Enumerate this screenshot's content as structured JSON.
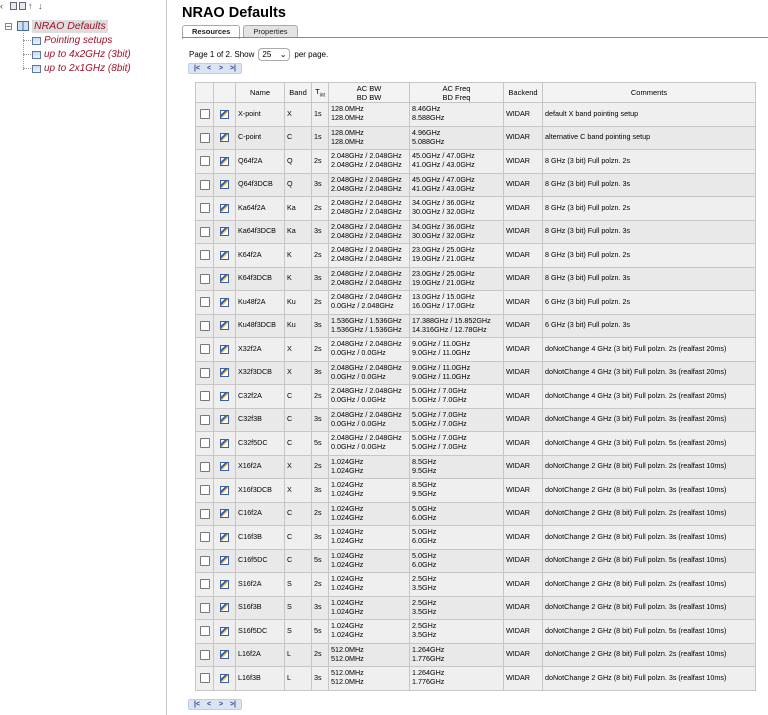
{
  "tree": {
    "root": {
      "label": "NRAO Defaults",
      "expander": "−"
    },
    "children": [
      {
        "label": "Pointing setups"
      },
      {
        "label": "up to 4x2GHz (3bit)"
      },
      {
        "label": "up to 2x1GHz (8bit)"
      }
    ]
  },
  "main": {
    "title": "NRAO Defaults",
    "tabs": [
      {
        "label": "Resources"
      },
      {
        "label": "Properties"
      }
    ],
    "pager": {
      "prefix": "Page 1 of 2. Show",
      "page_size": "25",
      "suffix": "per page."
    },
    "nav": {
      "first": "|<",
      "prev": "<",
      "next": ">",
      "last": ">|"
    }
  },
  "table": {
    "headers": {
      "name": "Name",
      "band": "Band",
      "tint": "T",
      "tint_sub": "int",
      "acbw": "AC BW",
      "bdbw": "BD BW",
      "acfreq": "AC Freq",
      "bdfreq": "BD Freq",
      "backend": "Backend",
      "comments": "Comments"
    },
    "rows": [
      {
        "name": "X-point",
        "band": "X",
        "tint": "1s",
        "bw1": "128.0MHz",
        "bw2": "128.0MHz",
        "f1": "8.46GHz",
        "f2": "8.588GHz",
        "backend": "WIDAR",
        "comment": "default X band pointing setup"
      },
      {
        "name": "C-point",
        "band": "C",
        "tint": "1s",
        "bw1": "128.0MHz",
        "bw2": "128.0MHz",
        "f1": "4.96GHz",
        "f2": "5.088GHz",
        "backend": "WIDAR",
        "comment": "alternative C band pointing setup"
      },
      {
        "name": "Q64f2A",
        "band": "Q",
        "tint": "2s",
        "bw1": "2.048GHz / 2.048GHz",
        "bw2": "2.048GHz / 2.048GHz",
        "f1": "45.0GHz / 47.0GHz",
        "f2": "41.0GHz / 43.0GHz",
        "backend": "WIDAR",
        "comment": "8 GHz (3 bit) Full polzn. 2s"
      },
      {
        "name": "Q64f3DCB",
        "band": "Q",
        "tint": "3s",
        "bw1": "2.048GHz / 2.048GHz",
        "bw2": "2.048GHz / 2.048GHz",
        "f1": "45.0GHz / 47.0GHz",
        "f2": "41.0GHz / 43.0GHz",
        "backend": "WIDAR",
        "comment": "8 GHz (3 bit) Full polzn. 3s"
      },
      {
        "name": "Ka64f2A",
        "band": "Ka",
        "tint": "2s",
        "bw1": "2.048GHz / 2.048GHz",
        "bw2": "2.048GHz / 2.048GHz",
        "f1": "34.0GHz / 36.0GHz",
        "f2": "30.0GHz / 32.0GHz",
        "backend": "WIDAR",
        "comment": "8 GHz (3 bit) Full polzn. 2s"
      },
      {
        "name": "Ka64f3DCB",
        "band": "Ka",
        "tint": "3s",
        "bw1": "2.048GHz / 2.048GHz",
        "bw2": "2.048GHz / 2.048GHz",
        "f1": "34.0GHz / 36.0GHz",
        "f2": "30.0GHz / 32.0GHz",
        "backend": "WIDAR",
        "comment": "8 GHz (3 bit) Full polzn. 3s"
      },
      {
        "name": "K64f2A",
        "band": "K",
        "tint": "2s",
        "bw1": "2.048GHz / 2.048GHz",
        "bw2": "2.048GHz / 2.048GHz",
        "f1": "23.0GHz / 25.0GHz",
        "f2": "19.0GHz / 21.0GHz",
        "backend": "WIDAR",
        "comment": "8 GHz (3 bit) Full polzn. 2s"
      },
      {
        "name": "K64f3DCB",
        "band": "K",
        "tint": "3s",
        "bw1": "2.048GHz / 2.048GHz",
        "bw2": "2.048GHz / 2.048GHz",
        "f1": "23.0GHz / 25.0GHz",
        "f2": "19.0GHz / 21.0GHz",
        "backend": "WIDAR",
        "comment": "8 GHz (3 bit) Full polzn. 3s"
      },
      {
        "name": "Ku48f2A",
        "band": "Ku",
        "tint": "2s",
        "bw1": "2.048GHz / 2.048GHz",
        "bw2": "0.0GHz / 2.048GHz",
        "f1": "13.0GHz / 15.0GHz",
        "f2": "16.0GHz / 17.0GHz",
        "backend": "WIDAR",
        "comment": "6 GHz (3 bit) Full polzn. 2s"
      },
      {
        "name": "Ku48f3DCB",
        "band": "Ku",
        "tint": "3s",
        "bw1": "1.536GHz / 1.536GHz",
        "bw2": "1.536GHz / 1.536GHz",
        "f1": "17.388GHz / 15.852GHz",
        "f2": "14.316GHz / 12.78GHz",
        "backend": "WIDAR",
        "comment": "6 GHz (3 bit) Full polzn. 3s"
      },
      {
        "name": "X32f2A",
        "band": "X",
        "tint": "2s",
        "bw1": "2.048GHz / 2.048GHz",
        "bw2": "0.0GHz / 0.0GHz",
        "f1": "9.0GHz / 11.0GHz",
        "f2": "9.0GHz / 11.0GHz",
        "backend": "WIDAR",
        "comment": "doNotChange 4 GHz (3 bit) Full polzn. 2s (realfast 20ms)"
      },
      {
        "name": "X32f3DCB",
        "band": "X",
        "tint": "3s",
        "bw1": "2.048GHz / 2.048GHz",
        "bw2": "0.0GHz / 0.0GHz",
        "f1": "9.0GHz / 11.0GHz",
        "f2": "9.0GHz / 11.0GHz",
        "backend": "WIDAR",
        "comment": "doNotChange 4 GHz (3 bit) Full polzn. 3s (realfast 20ms)"
      },
      {
        "name": "C32f2A",
        "band": "C",
        "tint": "2s",
        "bw1": "2.048GHz / 2.048GHz",
        "bw2": "0.0GHz / 0.0GHz",
        "f1": "5.0GHz / 7.0GHz",
        "f2": "5.0GHz / 7.0GHz",
        "backend": "WIDAR",
        "comment": "doNotChange 4 GHz (3 bit) Full polzn. 2s (realfast 20ms)"
      },
      {
        "name": "C32f3B",
        "band": "C",
        "tint": "3s",
        "bw1": "2.048GHz / 2.048GHz",
        "bw2": "0.0GHz / 0.0GHz",
        "f1": "5.0GHz / 7.0GHz",
        "f2": "5.0GHz / 7.0GHz",
        "backend": "WIDAR",
        "comment": "doNotChange 4 GHz (3 bit) Full polzn. 3s (realfast 20ms)"
      },
      {
        "name": "C32f5DC",
        "band": "C",
        "tint": "5s",
        "bw1": "2.048GHz / 2.048GHz",
        "bw2": "0.0GHz / 0.0GHz",
        "f1": "5.0GHz / 7.0GHz",
        "f2": "5.0GHz / 7.0GHz",
        "backend": "WIDAR",
        "comment": "doNotChange 4 GHz (3 bit) Full polzn. 5s (realfast 20ms)"
      },
      {
        "name": "X16f2A",
        "band": "X",
        "tint": "2s",
        "bw1": "1.024GHz",
        "bw2": "1.024GHz",
        "f1": "8.5GHz",
        "f2": "9.5GHz",
        "backend": "WIDAR",
        "comment": "doNotChange 2 GHz (8 bit) Full polzn. 2s (realfast 10ms)"
      },
      {
        "name": "X16f3DCB",
        "band": "X",
        "tint": "3s",
        "bw1": "1.024GHz",
        "bw2": "1.024GHz",
        "f1": "8.5GHz",
        "f2": "9.5GHz",
        "backend": "WIDAR",
        "comment": "doNotChange 2 GHz (8 bit) Full polzn. 3s (realfast 10ms)"
      },
      {
        "name": "C16f2A",
        "band": "C",
        "tint": "2s",
        "bw1": "1.024GHz",
        "bw2": "1.024GHz",
        "f1": "5.0GHz",
        "f2": "6.0GHz",
        "backend": "WIDAR",
        "comment": "doNotChange 2 GHz (8 bit) Full polzn. 2s (realfast 10ms)"
      },
      {
        "name": "C16f3B",
        "band": "C",
        "tint": "3s",
        "bw1": "1.024GHz",
        "bw2": "1.024GHz",
        "f1": "5.0GHz",
        "f2": "6.0GHz",
        "backend": "WIDAR",
        "comment": "doNotChange 2 GHz (8 bit) Full polzn. 3s (realfast 10ms)"
      },
      {
        "name": "C16f5DC",
        "band": "C",
        "tint": "5s",
        "bw1": "1.024GHz",
        "bw2": "1.024GHz",
        "f1": "5.0GHz",
        "f2": "6.0GHz",
        "backend": "WIDAR",
        "comment": "doNotChange 2 GHz (8 bit) Full polzn. 5s (realfast 10ms)"
      },
      {
        "name": "S16f2A",
        "band": "S",
        "tint": "2s",
        "bw1": "1.024GHz",
        "bw2": "1.024GHz",
        "f1": "2.5GHz",
        "f2": "3.5GHz",
        "backend": "WIDAR",
        "comment": "doNotChange 2 GHz (8 bit) Full polzn. 2s (realfast 10ms)"
      },
      {
        "name": "S16f3B",
        "band": "S",
        "tint": "3s",
        "bw1": "1.024GHz",
        "bw2": "1.024GHz",
        "f1": "2.5GHz",
        "f2": "3.5GHz",
        "backend": "WIDAR",
        "comment": "doNotChange 2 GHz (8 bit) Full polzn. 3s (realfast 10ms)"
      },
      {
        "name": "S16f5DC",
        "band": "S",
        "tint": "5s",
        "bw1": "1.024GHz",
        "bw2": "1.024GHz",
        "f1": "2.5GHz",
        "f2": "3.5GHz",
        "backend": "WIDAR",
        "comment": "doNotChange 2 GHz (8 bit) Full polzn. 5s (realfast 10ms)"
      },
      {
        "name": "L16f2A",
        "band": "L",
        "tint": "2s",
        "bw1": "512.0MHz",
        "bw2": "512.0MHz",
        "f1": "1.264GHz",
        "f2": "1.776GHz",
        "backend": "WIDAR",
        "comment": "doNotChange 2 GHz (8 bit) Full polzn. 2s (realfast 10ms)"
      },
      {
        "name": "L16f3B",
        "band": "L",
        "tint": "3s",
        "bw1": "512.0MHz",
        "bw2": "512.0MHz",
        "f1": "1.264GHz",
        "f2": "1.776GHz",
        "backend": "WIDAR",
        "comment": "doNotChange 2 GHz (8 bit) Full polzn. 3s (realfast 10ms)"
      }
    ]
  }
}
